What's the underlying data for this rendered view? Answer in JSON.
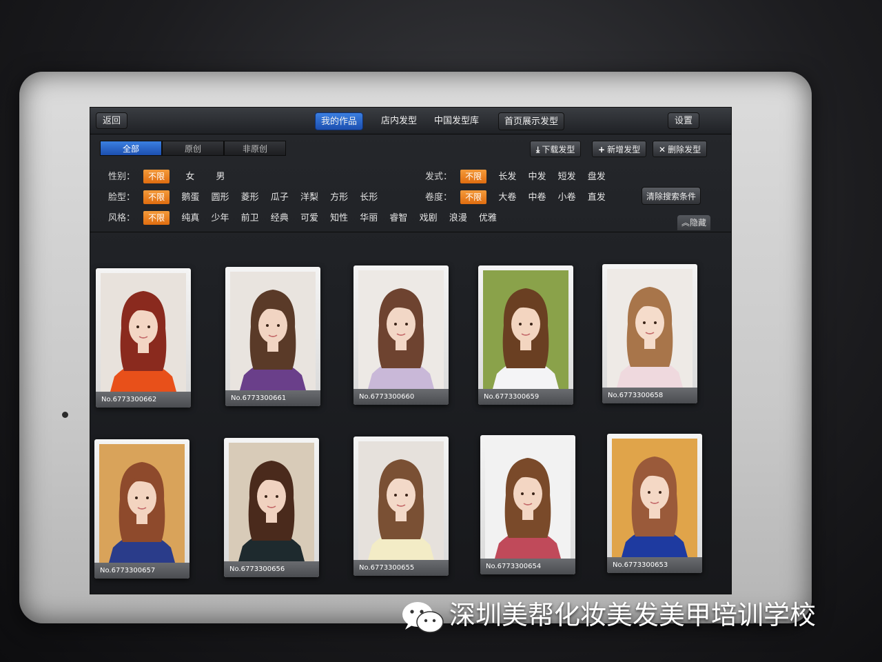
{
  "topbar": {
    "back": "返回",
    "tabs": [
      "我的作品",
      "店内发型",
      "中国发型库",
      "首页展示发型"
    ],
    "settings": "设置"
  },
  "segments": [
    "全部",
    "原创",
    "非原创"
  ],
  "actions": {
    "download": "下载发型",
    "add": "新增发型",
    "delete": "删除发型"
  },
  "filters": {
    "gender": {
      "label": "性别：",
      "options": [
        "不限",
        "女",
        "男"
      ]
    },
    "face": {
      "label": "脸型：",
      "options": [
        "不限",
        "鹅蛋",
        "圆形",
        "菱形",
        "瓜子",
        "洋梨",
        "方形",
        "长形"
      ]
    },
    "style": {
      "label": "风格：",
      "options": [
        "不限",
        "纯真",
        "少年",
        "前卫",
        "经典",
        "可爱",
        "知性",
        "华丽",
        "睿智",
        "戏剧",
        "浪漫",
        "优雅"
      ]
    },
    "hair": {
      "label": "发式：",
      "options": [
        "不限",
        "长发",
        "中发",
        "短发",
        "盘发"
      ]
    },
    "curl": {
      "label": "卷度：",
      "options": [
        "不限",
        "大卷",
        "中卷",
        "小卷",
        "直发"
      ]
    }
  },
  "clear_filters": "清除搜索条件",
  "hide": "隐藏",
  "cards": [
    {
      "id": "No.6773300662",
      "bg": "#e8e2dc",
      "hair": "#8a2a1e",
      "outfit": "#e8501a",
      "skin": "#f3d6c4"
    },
    {
      "id": "No.6773300661",
      "bg": "#e9e4df",
      "hair": "#5a3a28",
      "outfit": "#6a3f8a",
      "skin": "#f1d4c2"
    },
    {
      "id": "No.6773300660",
      "bg": "#ede9e5",
      "hair": "#6e4330",
      "outfit": "#c9b8d8",
      "skin": "#f2d7c6"
    },
    {
      "id": "No.6773300659",
      "bg": "#8aa24a",
      "hair": "#6a3f22",
      "outfit": "#f4f4f6",
      "skin": "#f3d5c0"
    },
    {
      "id": "No.6773300658",
      "bg": "#eeeae6",
      "hair": "#a8754a",
      "outfit": "#efd9de",
      "skin": "#f5dccb"
    },
    {
      "id": "No.6773300657",
      "bg": "#d9a35a",
      "hair": "#8e4a2c",
      "outfit": "#2a3c8a",
      "skin": "#f3d4c0"
    },
    {
      "id": "No.6773300656",
      "bg": "#d8cbb8",
      "hair": "#4a2a1c",
      "outfit": "#1e2a2e",
      "skin": "#f0d2c0"
    },
    {
      "id": "No.6773300655",
      "bg": "#e6e1dc",
      "hair": "#7a5034",
      "outfit": "#f3ecc6",
      "skin": "#f3d9c8"
    },
    {
      "id": "No.6773300654",
      "bg": "#f2f2f2",
      "hair": "#7a4a2a",
      "outfit": "#c04a5a",
      "skin": "#f3d6c3"
    },
    {
      "id": "No.6773300653",
      "bg": "#e0a44a",
      "hair": "#9a5a3a",
      "outfit": "#1e3aa0",
      "skin": "#f4d8c5"
    }
  ],
  "watermark": "深圳美帮化妆美发美甲培训学校"
}
